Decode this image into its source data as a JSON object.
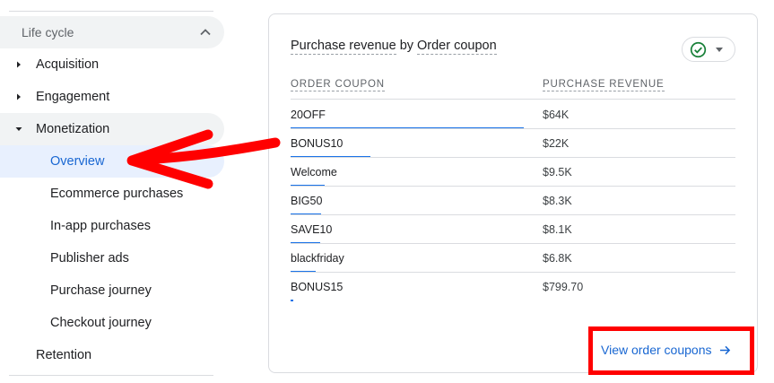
{
  "sidebar": {
    "section_label": "Life cycle",
    "items": [
      {
        "label": "Acquisition"
      },
      {
        "label": "Engagement"
      },
      {
        "label": "Monetization"
      }
    ],
    "monetization_subitems": [
      {
        "label": "Overview"
      },
      {
        "label": "Ecommerce purchases"
      },
      {
        "label": "In-app purchases"
      },
      {
        "label": "Publisher ads"
      },
      {
        "label": "Purchase journey"
      },
      {
        "label": "Checkout journey"
      }
    ],
    "retention_label": "Retention"
  },
  "card": {
    "title_metric": "Purchase revenue",
    "title_by": "by",
    "title_dimension": "Order coupon",
    "status_icon": "check-circle-icon",
    "columns": [
      "ORDER COUPON",
      "PURCHASE REVENUE"
    ],
    "rows": [
      {
        "coupon": "20OFF",
        "revenue": "$64K",
        "share": 1.0
      },
      {
        "coupon": "BONUS10",
        "revenue": "$22K",
        "share": 0.344
      },
      {
        "coupon": "Welcome",
        "revenue": "$9.5K",
        "share": 0.148
      },
      {
        "coupon": "BIG50",
        "revenue": "$8.3K",
        "share": 0.13
      },
      {
        "coupon": "SAVE10",
        "revenue": "$8.1K",
        "share": 0.127
      },
      {
        "coupon": "blackfriday",
        "revenue": "$6.8K",
        "share": 0.106
      },
      {
        "coupon": "BONUS15",
        "revenue": "$799.70",
        "share": 0.0125
      }
    ],
    "link_label": "View order coupons"
  },
  "colors": {
    "accent": "#1a73e8",
    "link": "#1967d2",
    "active_bg": "#e8f0fe",
    "annotation": "#ff0000"
  }
}
